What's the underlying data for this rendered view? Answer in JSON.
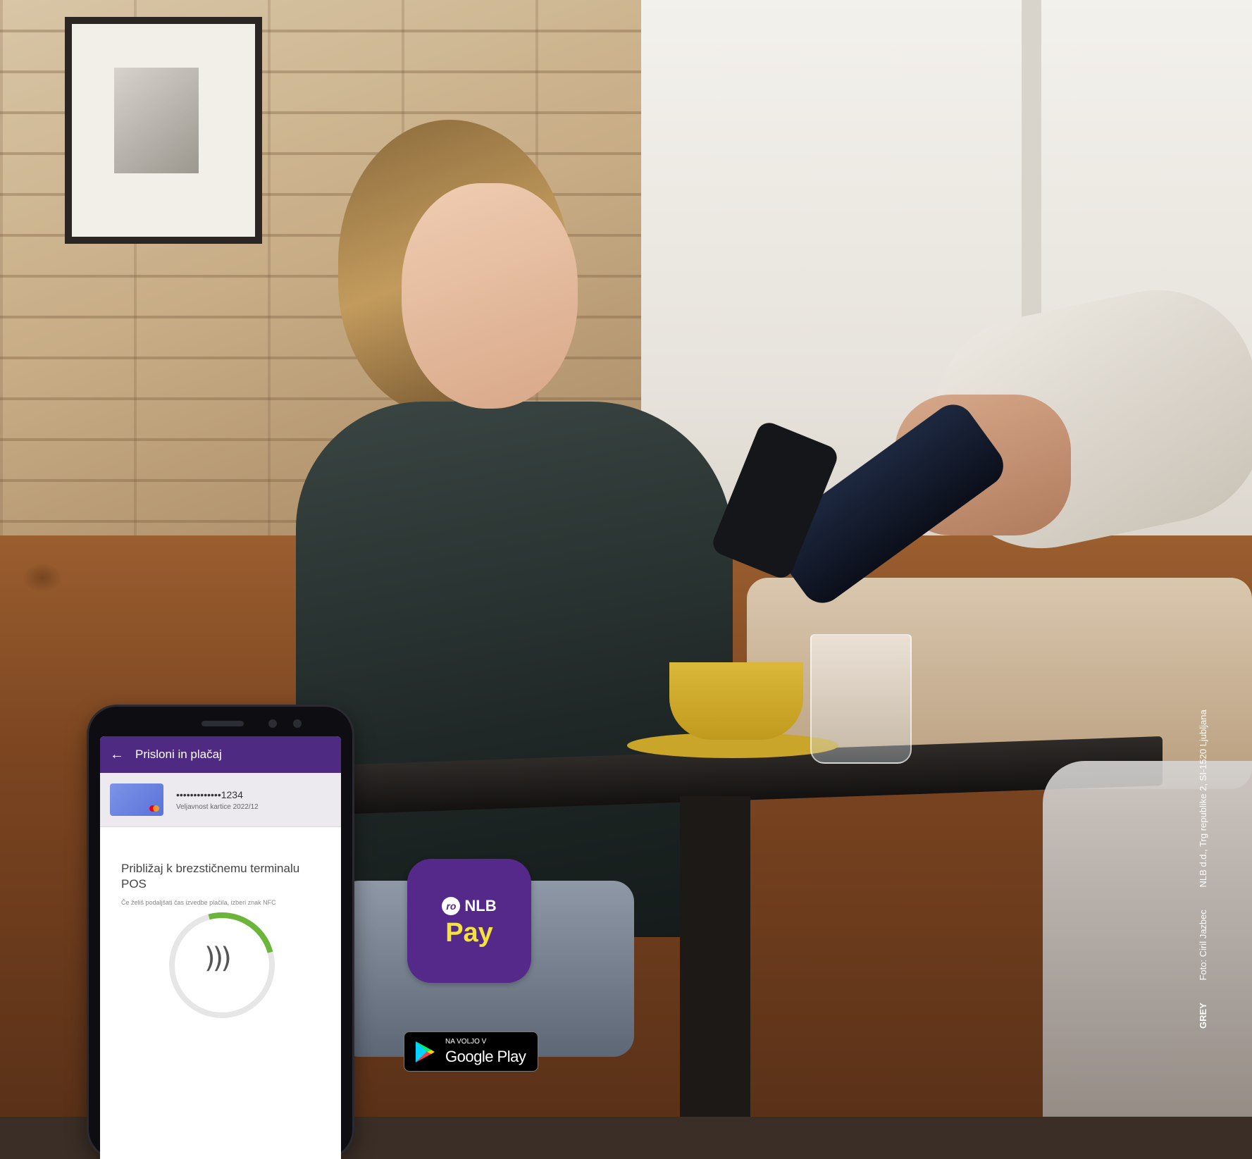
{
  "phone_screen": {
    "title": "Prisloni in plačaj",
    "card_number": "•••••••••••••1234",
    "card_expiry": "Veljavnost kartice 2022/12",
    "prompt_title": "Približaj k brezstičnemu terminalu POS",
    "prompt_subtitle": "Če želiš podaljšati čas izvedbe plačila, izberi znak NFC"
  },
  "app_badge": {
    "brand": "NLB",
    "product": "Pay"
  },
  "store_badge": {
    "small_text": "NA VOLJO V",
    "big_text": "Google Play"
  },
  "credit": {
    "agency": "GREY",
    "photo": "Foto: Ciril Jazbec",
    "address": "NLB d.d., Trg republike 2, SI-1520 Ljubljana"
  },
  "colors": {
    "brand_purple": "#55298a",
    "pay_yellow": "#f3e33a",
    "nfc_progress": "#6bb53a"
  }
}
